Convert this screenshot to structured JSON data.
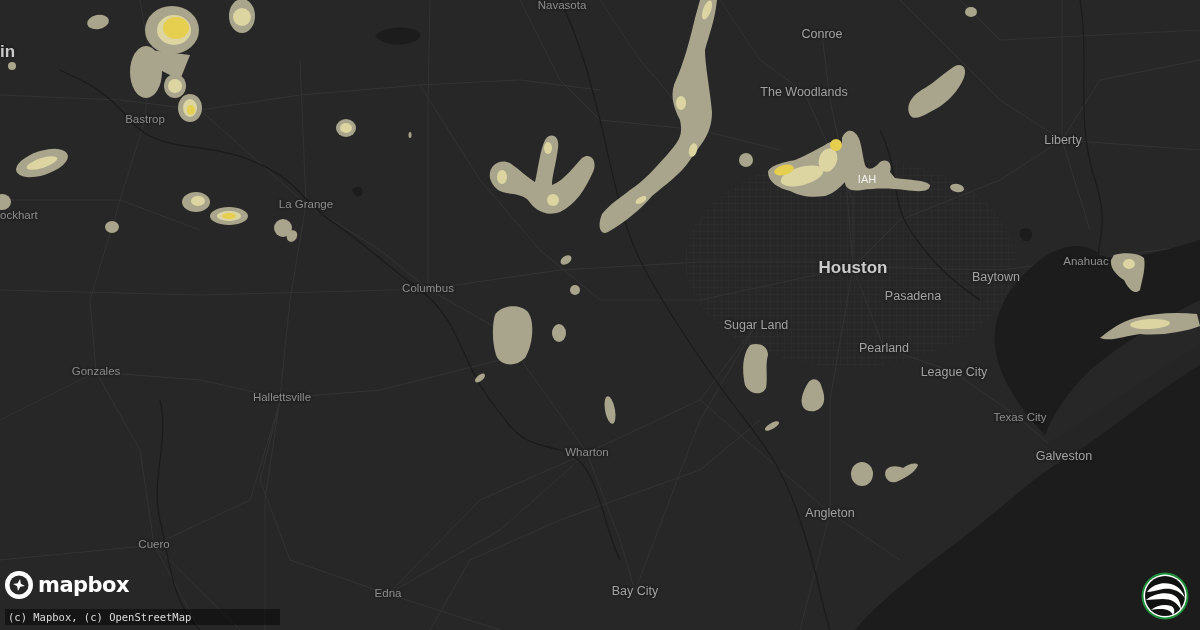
{
  "map": {
    "labels": [
      {
        "text": "Navasota",
        "kind": "town"
      },
      {
        "text": "in",
        "kind": "major"
      },
      {
        "text": "Bastrop",
        "kind": "town"
      },
      {
        "text": "ockhart",
        "kind": "town"
      },
      {
        "text": "La Grange",
        "kind": "town"
      },
      {
        "text": "Columbus",
        "kind": "town"
      },
      {
        "text": "Conroe",
        "kind": "city"
      },
      {
        "text": "The Woodlands",
        "kind": "city"
      },
      {
        "text": "Liberty",
        "kind": "city"
      },
      {
        "text": "IAH",
        "kind": "airport"
      },
      {
        "text": "Houston",
        "kind": "major"
      },
      {
        "text": "Baytown",
        "kind": "city"
      },
      {
        "text": "Anahuac",
        "kind": "town"
      },
      {
        "text": "Pasadena",
        "kind": "city"
      },
      {
        "text": "Sugar Land",
        "kind": "city"
      },
      {
        "text": "Pearland",
        "kind": "city"
      },
      {
        "text": "League City",
        "kind": "city"
      },
      {
        "text": "Gonzales",
        "kind": "town"
      },
      {
        "text": "Hallettsville",
        "kind": "town"
      },
      {
        "text": "Texas City",
        "kind": "town"
      },
      {
        "text": "Wharton",
        "kind": "town"
      },
      {
        "text": "Galveston",
        "kind": "city"
      },
      {
        "text": "Angleton",
        "kind": "city"
      },
      {
        "text": "Cuero",
        "kind": "town"
      },
      {
        "text": "Bay City",
        "kind": "city"
      },
      {
        "text": "Edna",
        "kind": "town"
      }
    ]
  },
  "branding": {
    "logo_text": "mapbox",
    "attribution": "(c) Mapbox, (c) OpenStreetMap"
  }
}
